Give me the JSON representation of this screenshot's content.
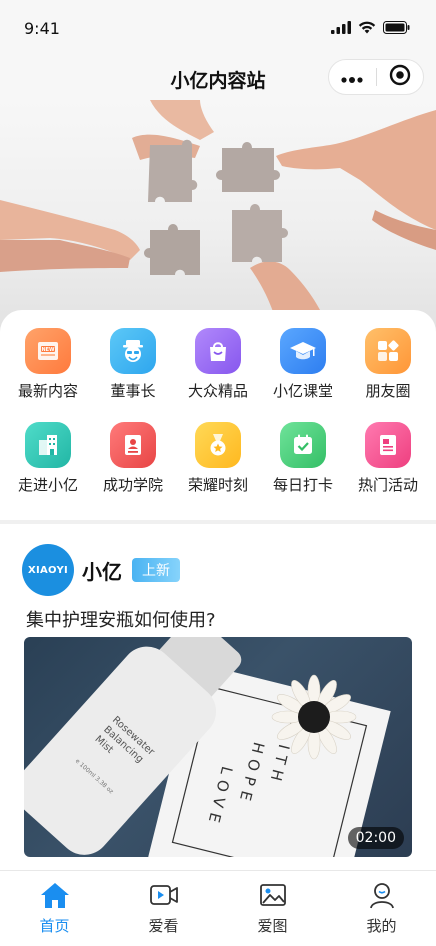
{
  "status_bar": {
    "time": "9:41"
  },
  "nav": {
    "title": "小亿内容站",
    "more_icon": "more-dots-icon",
    "close_icon": "target-circle-icon"
  },
  "banner": {
    "description_icon": "puzzle-hands-image"
  },
  "menu": {
    "items": [
      {
        "label": "最新内容",
        "icon": "new-icon",
        "color": "#ff8a4c",
        "badge": "NEW"
      },
      {
        "label": "董事长",
        "icon": "chairman-icon",
        "color": "#3fb6f2"
      },
      {
        "label": "大众精品",
        "icon": "shopping-bag-icon",
        "color": "#9b6cf5"
      },
      {
        "label": "小亿课堂",
        "icon": "graduation-cap-icon",
        "color": "#3b8ff3"
      },
      {
        "label": "朋友圈",
        "icon": "grid-apps-icon",
        "color": "#ffa44a"
      },
      {
        "label": "走进小亿",
        "icon": "building-icon",
        "color": "#33c8b8"
      },
      {
        "label": "成功学院",
        "icon": "id-card-icon",
        "color": "#f25c5c"
      },
      {
        "label": "荣耀时刻",
        "icon": "medal-icon",
        "color": "#ffc52e"
      },
      {
        "label": "每日打卡",
        "icon": "calendar-check-icon",
        "color": "#4cd07a"
      },
      {
        "label": "热门活动",
        "icon": "document-icon",
        "color": "#f5568f"
      }
    ]
  },
  "post": {
    "avatar_text": "XIAOYI",
    "author": "小亿",
    "badge": "上新",
    "title": "集中护理安瓶如何使用?",
    "duration": "02:00",
    "bottle_text": [
      "Rosewater",
      "Balancing",
      "Mist",
      "e 100ml  3.38 oz"
    ],
    "card_text": [
      "FAITH",
      "HOPE",
      "LOVE"
    ]
  },
  "tabs": [
    {
      "label": "首页",
      "icon": "home-icon",
      "active": true
    },
    {
      "label": "爱看",
      "icon": "video-icon",
      "active": false
    },
    {
      "label": "爱图",
      "icon": "image-icon",
      "active": false
    },
    {
      "label": "我的",
      "icon": "user-icon",
      "active": false
    }
  ],
  "colors": {
    "accent": "#1a8ef0",
    "badge": "#4ab3f2"
  }
}
